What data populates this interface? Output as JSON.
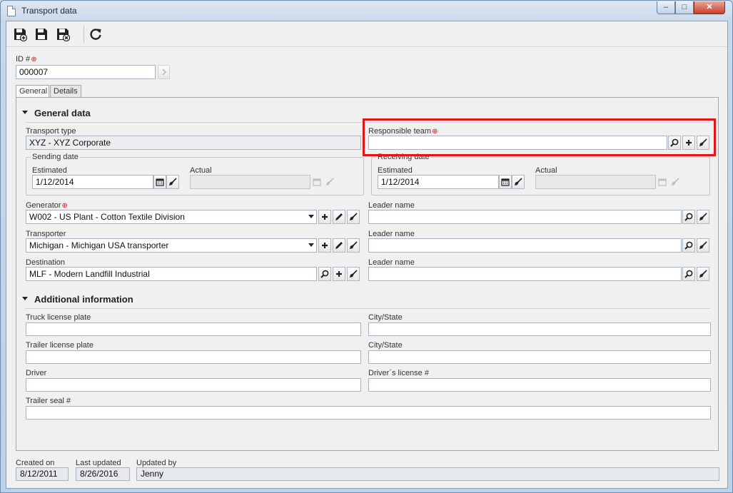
{
  "window": {
    "title": "Transport data",
    "minimize": "‒",
    "maximize": "□",
    "close": "✕"
  },
  "toolbar": {
    "icons": [
      "save-new-icon",
      "save-icon",
      "save-close-icon",
      "refresh-icon"
    ]
  },
  "id_field": {
    "label": "ID #",
    "value": "000007"
  },
  "tabs": [
    {
      "label": "General"
    },
    {
      "label": "Details"
    }
  ],
  "general": {
    "title": "General data",
    "transport_type": {
      "label": "Transport type",
      "value": "XYZ - XYZ Corporate"
    },
    "responsible_team": {
      "label": "Responsible team",
      "value": ""
    },
    "sending_date": {
      "title": "Sending date",
      "estimated_label": "Estimated",
      "estimated_value": "1/12/2014",
      "actual_label": "Actual",
      "actual_value": ""
    },
    "receiving_date": {
      "title": "Receiving date",
      "estimated_label": "Estimated",
      "estimated_value": "1/12/2014",
      "actual_label": "Actual",
      "actual_value": ""
    },
    "generator": {
      "label": "Generator",
      "value": "W002 - US Plant - Cotton Textile Division"
    },
    "transporter": {
      "label": "Transporter",
      "value": "Michigan - Michigan USA transporter"
    },
    "destination": {
      "label": "Destination",
      "value": "MLF - Modern Landfill Industrial"
    },
    "leader1": {
      "label": "Leader name",
      "value": ""
    },
    "leader2": {
      "label": "Leader name",
      "value": ""
    },
    "leader3": {
      "label": "Leader name",
      "value": ""
    }
  },
  "additional": {
    "title": "Additional information",
    "truck_plate": {
      "label": "Truck license plate",
      "value": ""
    },
    "city1": {
      "label": "City/State",
      "value": ""
    },
    "trailer_plate": {
      "label": "Trailer license plate",
      "value": ""
    },
    "city2": {
      "label": "City/State",
      "value": ""
    },
    "driver": {
      "label": "Driver",
      "value": ""
    },
    "drivers_license": {
      "label": "Driver´s license #",
      "value": ""
    },
    "trailer_seal": {
      "label": "Trailer seal #",
      "value": ""
    }
  },
  "footer": {
    "created_label": "Created on",
    "created_value": "8/12/2011",
    "updated_label": "Last updated",
    "updated_value": "8/26/2016",
    "updated_by_label": "Updated by",
    "updated_by_value": "Jenny"
  },
  "colors": {
    "highlight": "#e0161a",
    "required": "#dd1111"
  }
}
